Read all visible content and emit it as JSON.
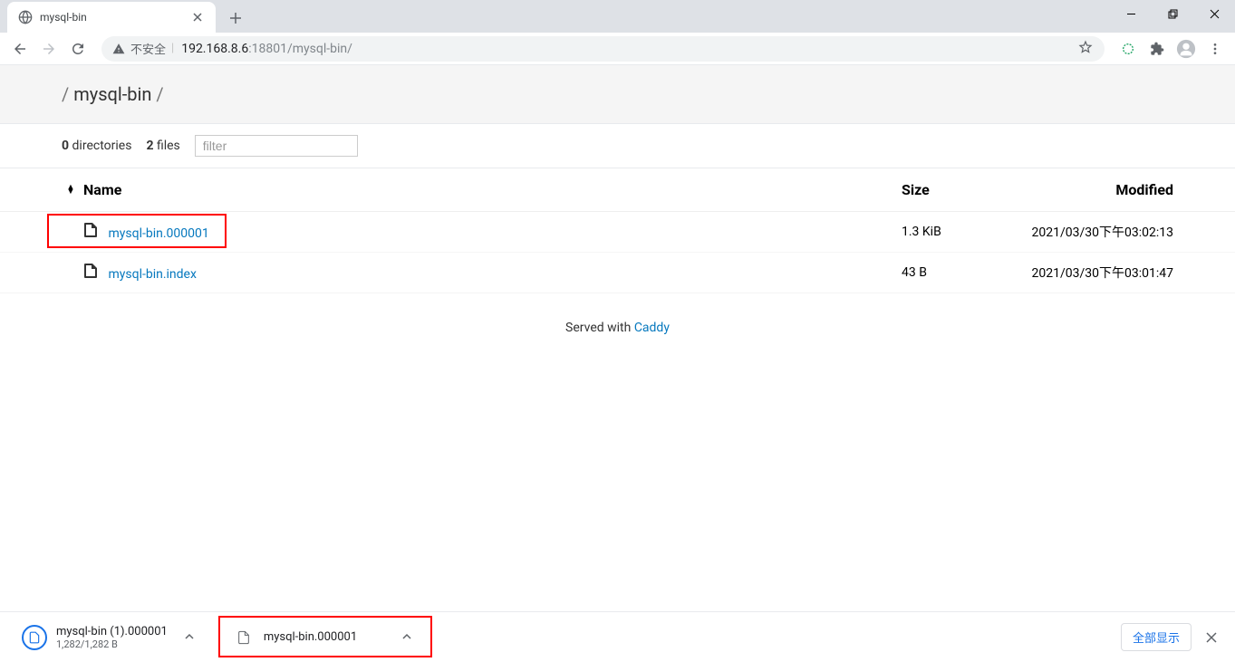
{
  "tab": {
    "title": "mysql-bin"
  },
  "address": {
    "security_label": "不安全",
    "host": "192.168.8.6",
    "port": ":18801",
    "path": "/mysql-bin/"
  },
  "breadcrumb": {
    "segments": [
      "mysql-bin"
    ]
  },
  "stats": {
    "dir_count": "0",
    "dir_label": "directories",
    "file_count": "2",
    "file_label": "files",
    "filter_placeholder": "filter"
  },
  "headers": {
    "name": "Name",
    "size": "Size",
    "modified": "Modified"
  },
  "files": [
    {
      "name": "mysql-bin.000001",
      "size": "1.3 KiB",
      "modified": "2021/03/30下午03:02:13",
      "highlighted": true
    },
    {
      "name": "mysql-bin.index",
      "size": "43 B",
      "modified": "2021/03/30下午03:01:47",
      "highlighted": false
    }
  ],
  "footer": {
    "prefix": "Served with ",
    "link": "Caddy"
  },
  "downloads": {
    "item1": {
      "name": "mysql-bin (1).000001",
      "size": "1,282/1,282 B"
    },
    "item2": {
      "name": "mysql-bin.000001"
    },
    "show_all": "全部显示"
  }
}
